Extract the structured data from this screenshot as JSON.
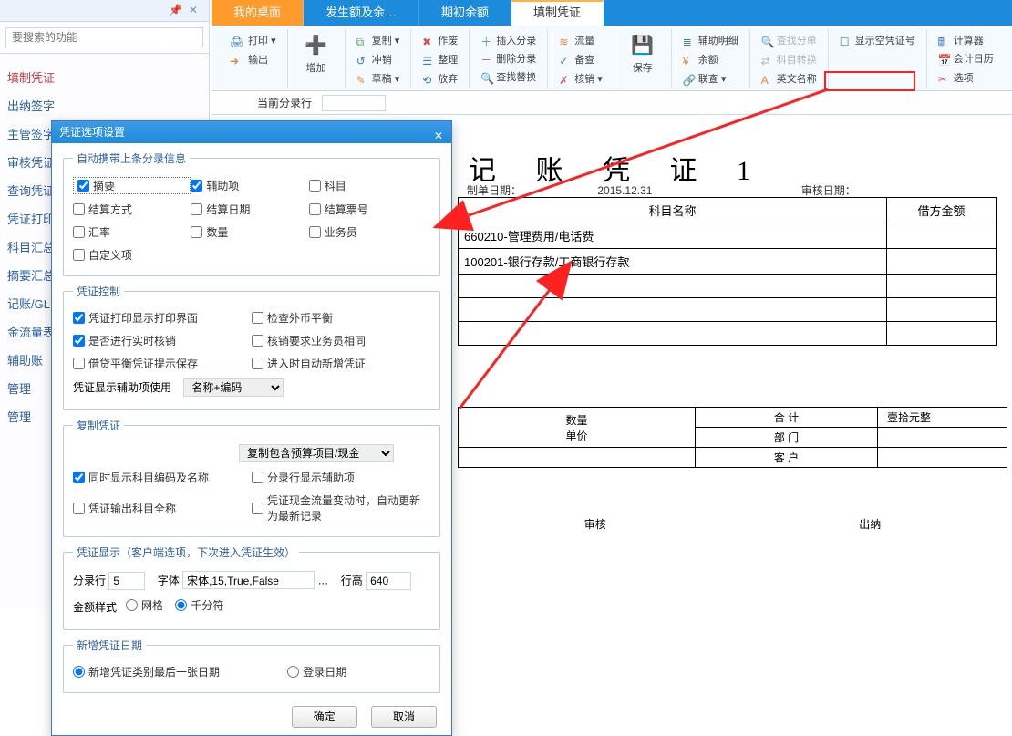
{
  "nav": {
    "search_placeholder": "要搜索的功能",
    "items": [
      {
        "label": "填制凭证"
      },
      {
        "label": "出纳签字"
      },
      {
        "label": "主管签字"
      },
      {
        "label": "审核凭证"
      },
      {
        "label": "查询凭证"
      },
      {
        "label": "凭证打印"
      },
      {
        "label": "科目汇总"
      },
      {
        "label": "摘要汇总"
      },
      {
        "label": "记账/GL"
      },
      {
        "label": "金流量表"
      },
      {
        "label": "辅助账"
      },
      {
        "label": "管理"
      },
      {
        "label": "管理"
      }
    ]
  },
  "tabs": [
    {
      "label": "我的桌面"
    },
    {
      "label": "发生额及余…"
    },
    {
      "label": "期初余额"
    },
    {
      "label": "填制凭证"
    }
  ],
  "ribbon": {
    "print": "打印",
    "output": "输出",
    "add": "增加",
    "copy": "复制",
    "reverse": "冲销",
    "draft": "草稿",
    "invalidate": "作废",
    "adjust": "整理",
    "abandon": "放弃",
    "insertRow": "插入分录",
    "deleteRow": "删除分录",
    "findReplace": "查找替换",
    "flow": "流量",
    "verify": "备查",
    "audit": "核销",
    "save": "保存",
    "aux": "辅助明细",
    "balance": "余额",
    "linkview": "联查",
    "search": "查找分单",
    "subjtrans": "科目转换",
    "engname": "英文名称",
    "showempty": "显示空凭证号",
    "calc": "计算器",
    "caldate": "会计日历",
    "options": "选项"
  },
  "subrow": {
    "label": "当前分录行"
  },
  "voucher": {
    "title": "记 账 凭 证",
    "no": "1",
    "make_date_label": "制单日期：",
    "make_date": "2015.12.31",
    "audit_date_label": "审核日期：",
    "col_subject": "科目名称",
    "col_debit": "借方金额",
    "rows": [
      {
        "subject": "660210-管理费用/电话费"
      },
      {
        "subject": "100201-银行存款/工商银行存款"
      }
    ],
    "qty_label": "数量",
    "price_label": "单价",
    "total_label": "合 计",
    "total_text": "壹拾元整",
    "dept_label": "部 门",
    "cust_label": "客 户",
    "audit_label": "审核",
    "cashier_label": "出纳"
  },
  "dialog": {
    "title": "凭证选项设置",
    "g1_legend": "自动携带上条分录信息",
    "chk_summary": "摘要",
    "chk_aux": "辅助项",
    "chk_subject": "科目",
    "chk_settletype": "结算方式",
    "chk_settledate": "结算日期",
    "chk_settlebill": "结算票号",
    "chk_rate": "汇率",
    "chk_qty": "数量",
    "chk_operator": "业务员",
    "chk_custom": "自定义项",
    "g2_legend": "凭证控制",
    "chk_printui": "凭证打印显示打印界面",
    "chk_fxcheck": "检查外币平衡",
    "chk_rtaudit": "是否进行实时核销",
    "chk_auditop": "核销要求业务员相同",
    "chk_balprompt": "借贷平衡凭证提示保存",
    "chk_autonew": "进入时自动新增凭证",
    "aux_label": "凭证显示辅助项使用",
    "aux_select": "名称+编码",
    "g3_legend": "复制凭证",
    "copy_select": "复制包含预算项目/现金",
    "chk_showcode": "同时显示科目编码及名称",
    "chk_rowaux": "分录行显示辅助项",
    "chk_fullsubj": "凭证输出科目全称",
    "chk_cashflow": "凭证现金流量变动时，自动更新为最新记录",
    "g4_legend": "凭证显示（客户端选项，下次进入凭证生效）",
    "rows_label": "分录行",
    "rows_value": "5",
    "font_label": "字体",
    "font_value": "宋体,15,True,False",
    "rowh_label": "行高",
    "rowh_value": "640",
    "amtstyle_label": "金额样式",
    "amtstyle_grid": "网格",
    "amtstyle_thou": "千分符",
    "g5_legend": "新增凭证日期",
    "newdate_last": "新增凭证类别最后一张日期",
    "newdate_login": "登录日期",
    "btn_ok": "确定",
    "btn_cancel": "取消"
  }
}
